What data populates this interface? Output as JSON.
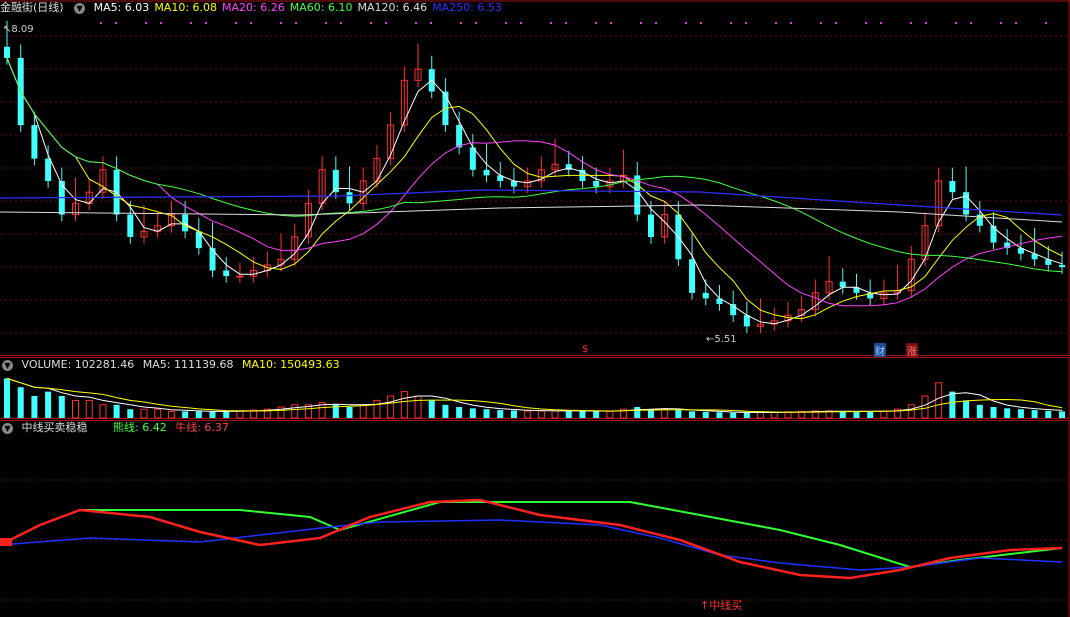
{
  "price": {
    "name": "金融街",
    "period": "(日线)",
    "ma": [
      {
        "label": "MA5: 6.03",
        "color": "#ffffff"
      },
      {
        "label": "MA10: 6.08",
        "color": "#ffff00"
      },
      {
        "label": "MA20: 6.26",
        "color": "#ff40ff"
      },
      {
        "label": "MA60: 6.10",
        "color": "#40ff40"
      },
      {
        "label": "MA120: 6.46",
        "color": "#dddddd"
      },
      {
        "label": "MA250: 6.53",
        "color": "#3030ff"
      }
    ],
    "high_label": "8.09",
    "low_label": "5.51",
    "markers": [
      {
        "text": "$",
        "color": "#ff3030"
      },
      {
        "text": "财",
        "color": "#6ab0ff"
      },
      {
        "text": "涨",
        "color": "#ff5050"
      }
    ],
    "close_series": [
      7.9,
      7.3,
      7.0,
      6.8,
      6.5,
      6.6,
      6.7,
      6.9,
      6.5,
      6.3,
      6.35,
      6.4,
      6.5,
      6.35,
      6.2,
      6.0,
      5.95,
      5.95,
      6.0,
      6.05,
      6.1,
      6.3,
      6.6,
      6.9,
      6.7,
      6.6,
      6.8,
      7.0,
      7.3,
      7.7,
      7.8,
      7.6,
      7.3,
      7.1,
      6.9,
      6.85,
      6.8,
      6.75,
      6.8,
      6.9,
      6.95,
      6.9,
      6.8,
      6.75,
      6.8,
      6.85,
      6.5,
      6.3,
      6.5,
      6.1,
      5.8,
      5.75,
      5.7,
      5.6,
      5.5,
      5.52,
      5.55,
      5.6,
      5.65,
      5.8,
      5.9,
      5.85,
      5.8,
      5.75,
      5.8,
      5.82,
      6.1,
      6.4,
      6.8,
      6.7,
      6.5,
      6.4,
      6.25,
      6.2,
      6.15,
      6.1,
      6.05,
      6.03
    ],
    "colors": {
      "up": "#ff3030",
      "down": "#40ffff"
    }
  },
  "volume": {
    "title": "VOLUME: 102281.46",
    "ma5": "MA5: 111139.68",
    "ma10": "MA10: 150493.63",
    "bars": [
      9,
      7,
      5,
      6,
      5,
      4,
      4,
      3,
      3,
      2,
      2,
      2,
      1.5,
      1.5,
      1.5,
      1.5,
      1.5,
      1.6,
      1.8,
      2,
      2.5,
      3,
      3,
      3.5,
      3,
      2.5,
      3,
      4,
      5,
      6,
      5,
      4,
      3,
      2.5,
      2.2,
      2,
      1.8,
      1.7,
      1.6,
      1.6,
      1.6,
      1.7,
      1.6,
      1.5,
      1.5,
      2,
      2.5,
      2,
      2,
      1.8,
      1.5,
      1.4,
      1.3,
      1.2,
      1.2,
      1.3,
      1.3,
      1.4,
      1.5,
      1.6,
      1.6,
      1.5,
      1.5,
      1.5,
      1.6,
      2,
      3,
      5,
      8,
      6,
      4,
      3,
      2.5,
      2.2,
      2,
      1.8,
      1.6,
      1.5
    ]
  },
  "indicator": {
    "title": "中线买卖稳稳",
    "bear_label": "熊线: 6.42",
    "bull_label": "牛线: 6.37",
    "signal": "中线买"
  }
}
